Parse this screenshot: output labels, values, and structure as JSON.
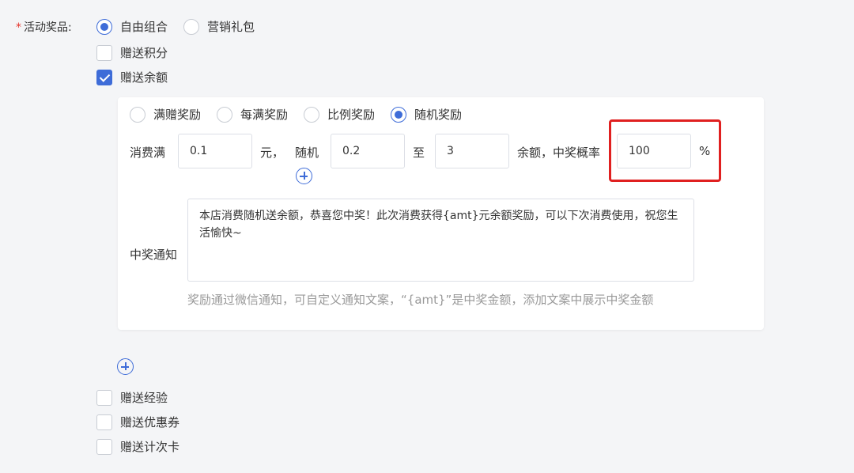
{
  "form": {
    "required_mark": "*",
    "label": "活动奖品:"
  },
  "prize_type": {
    "options": [
      "自由组合",
      "营销礼包"
    ],
    "selected": "自由组合"
  },
  "gifts": {
    "points": {
      "label": "赠送积分",
      "checked": false
    },
    "balance": {
      "label": "赠送余额",
      "checked": true
    },
    "experience": {
      "label": "赠送经验",
      "checked": false
    },
    "coupon": {
      "label": "赠送优惠券",
      "checked": false
    },
    "count_card": {
      "label": "赠送计次卡",
      "checked": false
    }
  },
  "reward_modes": {
    "options": [
      "满赠奖励",
      "每满奖励",
      "比例奖励",
      "随机奖励"
    ],
    "selected": "随机奖励"
  },
  "rule": {
    "spend_label": "消费满",
    "spend_value": "0.1",
    "yuan_label": "元，",
    "random_label": "随机",
    "random_min": "0.2",
    "to_label": "至",
    "random_max": "3",
    "balance_prob_label": "余额，中奖概率",
    "probability": "100",
    "percent": "%"
  },
  "notice": {
    "label": "中奖通知",
    "text": "本店消费随机送余额，恭喜您中奖！此次消费获得{amt}元余额奖励，可以下次消费使用，祝您生活愉快~",
    "hint": "奖励通过微信通知，可自定义通知文案，“{amt}”是中奖金额，添加文案中展示中奖金额"
  },
  "colors": {
    "accent": "#3e6cd8",
    "highlight": "#e02020",
    "required": "#e5332a"
  },
  "icons": {
    "add": "plus-circle-icon"
  }
}
